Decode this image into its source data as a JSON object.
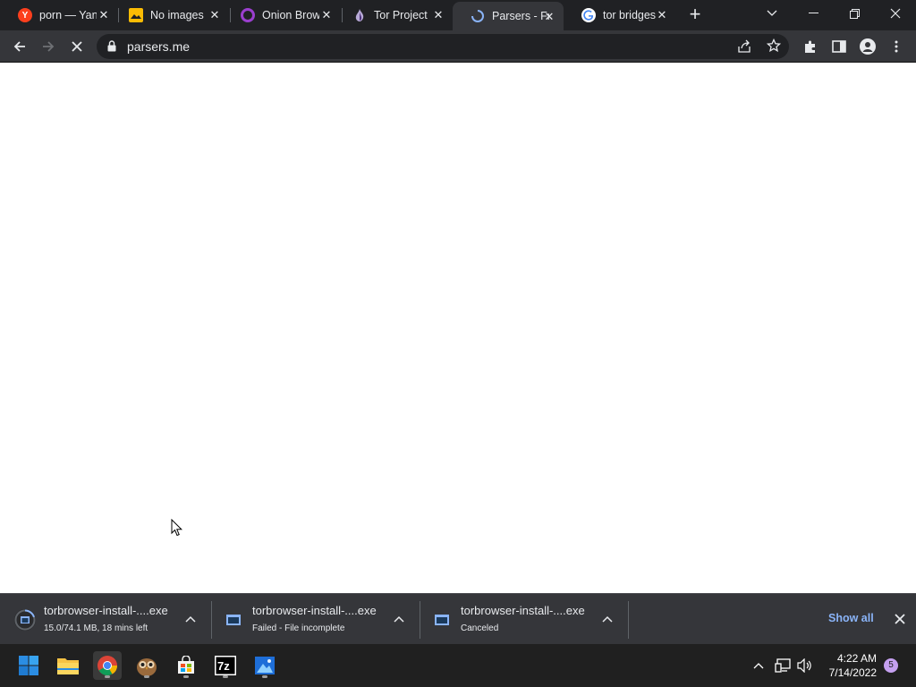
{
  "browser": {
    "tabs": [
      {
        "title": "porn — Yan",
        "favicon": "yandex-icon",
        "color": "#fc3f1d",
        "active": false
      },
      {
        "title": "No images",
        "favicon": "image-icon",
        "color": "#fbbc04",
        "active": false
      },
      {
        "title": "Onion Brow",
        "favicon": "onion-icon",
        "color": "#7d4698",
        "active": false
      },
      {
        "title": "Tor Project",
        "favicon": "tor-icon",
        "color": "#7e5ca5",
        "active": false
      },
      {
        "title": "Parsers - Fr",
        "favicon": "loading-spinner-icon",
        "color": "#8ab4f8",
        "active": true
      },
      {
        "title": "tor bridges",
        "favicon": "google-icon",
        "color": "#4285f4",
        "active": false
      }
    ],
    "address_bar": {
      "url": "parsers.me"
    },
    "loading": true
  },
  "downloads": {
    "items": [
      {
        "file_name": "torbrowser-install-....exe",
        "status": "15.0/74.1 MB, 18 mins left",
        "progress": 0.2
      },
      {
        "file_name": "torbrowser-install-....exe",
        "status": "Failed - File incomplete"
      },
      {
        "file_name": "torbrowser-install-....exe",
        "status": "Canceled"
      }
    ],
    "show_all_label": "Show all"
  },
  "taskbar": {
    "apps": [
      "start-icon",
      "file-explorer-icon",
      "chrome-icon",
      "owl-app-icon",
      "store-icon",
      "7zip-icon",
      "photos-icon"
    ],
    "clock": {
      "time": "4:22 AM",
      "date": "7/14/2022"
    },
    "notification_count": "5"
  },
  "colors": {
    "accent": "#8ab4f8",
    "tab_bg": "#202124",
    "toolbar_bg": "#35363a"
  }
}
